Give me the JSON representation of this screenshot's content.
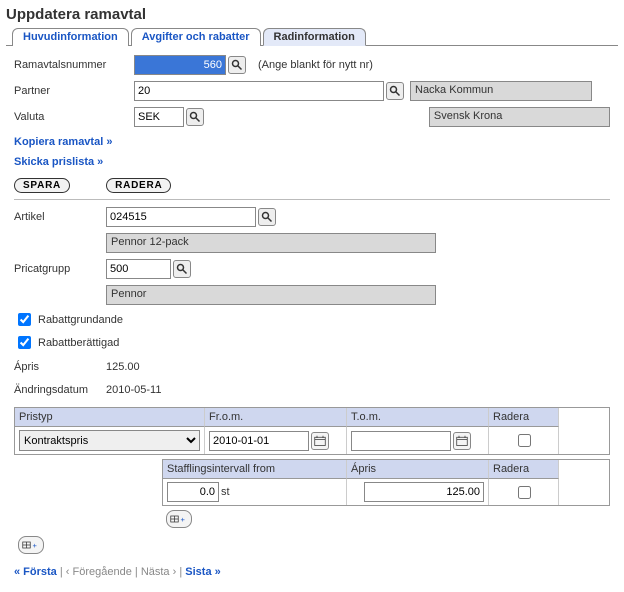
{
  "page_title": "Uppdatera ramavtal",
  "tabs": [
    {
      "label": "Huvudinformation",
      "active": false
    },
    {
      "label": "Avgifter och rabatter",
      "active": false
    },
    {
      "label": "Radinformation",
      "active": true
    }
  ],
  "header": {
    "ramavtal_label": "Ramavtalsnummer",
    "ramavtal_value": "560",
    "ramavtal_hint": "(Ange blankt för nytt nr)",
    "partner_label": "Partner",
    "partner_value": "20",
    "partner_name": "Nacka Kommun",
    "valuta_label": "Valuta",
    "valuta_value": "SEK",
    "valuta_name": "Svensk Krona"
  },
  "links": {
    "copy": "Kopiera ramavtal »",
    "send": "Skicka prislista »"
  },
  "buttons": {
    "save": "SPARA",
    "delete": "RADERA"
  },
  "line": {
    "artikel_label": "Artikel",
    "artikel_value": "024515",
    "artikel_name": "Pennor 12-pack",
    "pricat_label": "Pricatgrupp",
    "pricat_value": "500",
    "pricat_name": "Pennor",
    "rabatt1_label": "Rabattgrundande",
    "rabatt1_checked": true,
    "rabatt2_label": "Rabattberättigad",
    "rabatt2_checked": true,
    "apris_label": "Ápris",
    "apris_value": "125.00",
    "andring_label": "Ändringsdatum",
    "andring_value": "2010-05-11"
  },
  "price_grid": {
    "col_pristyp": "Pristyp",
    "col_from": "Fr.o.m.",
    "col_tom": "T.o.m.",
    "col_radera": "Radera",
    "rows": [
      {
        "pristyp": "Kontraktspris",
        "from": "2010-01-01",
        "tom": "",
        "radera": false
      }
    ]
  },
  "staff_grid": {
    "col_interval": "Stafflingsintervall from",
    "col_apris": "Ápris",
    "col_radera": "Radera",
    "unit": "st",
    "rows": [
      {
        "interval": "0.0",
        "apris": "125.00",
        "radera": false
      }
    ]
  },
  "pager": {
    "first": "« Första",
    "prev": "‹ Föregående",
    "next": "Nästa ›",
    "last": "Sista »"
  }
}
